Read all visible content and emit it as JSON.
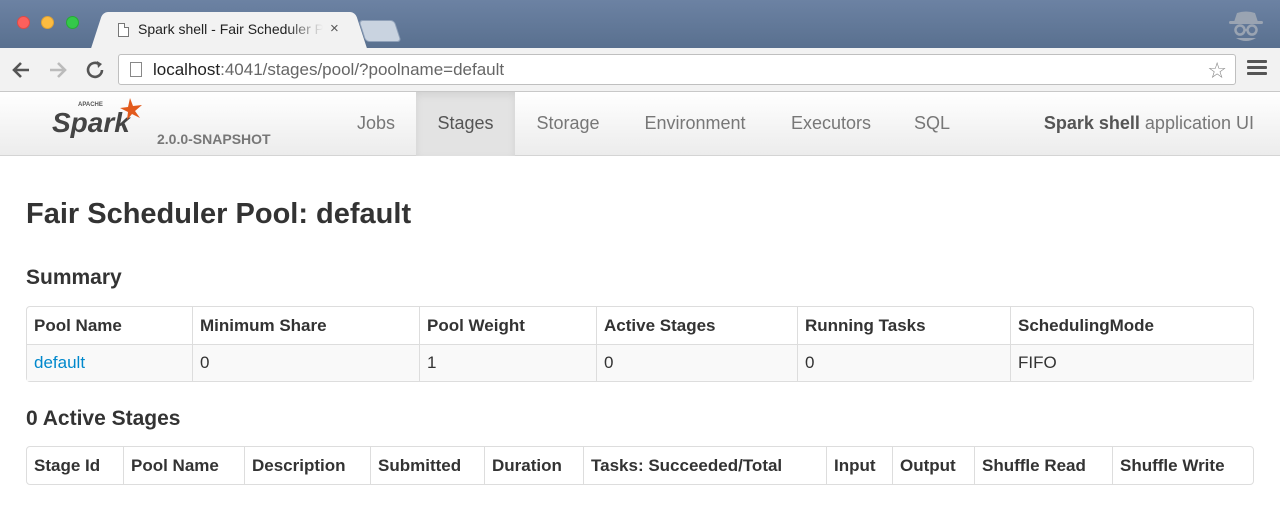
{
  "browser": {
    "tab_title": "Spark shell - Fair Scheduler Pool: default",
    "tab_close": "×",
    "url_host": "localhost",
    "url_rest": ":4041/stages/pool/?poolname=default",
    "star_icon": "☆"
  },
  "navbar": {
    "brand_version": "2.0.0-SNAPSHOT",
    "items": [
      {
        "label": "Jobs"
      },
      {
        "label": "Stages"
      },
      {
        "label": "Storage"
      },
      {
        "label": "Environment"
      },
      {
        "label": "Executors"
      },
      {
        "label": "SQL"
      }
    ],
    "active_item": "Stages",
    "app_name_bold": "Spark shell",
    "app_name_rest": " application UI"
  },
  "page": {
    "title": "Fair Scheduler Pool: default"
  },
  "summary": {
    "heading": "Summary",
    "headers": [
      "Pool Name",
      "Minimum Share",
      "Pool Weight",
      "Active Stages",
      "Running Tasks",
      "SchedulingMode"
    ],
    "row": [
      "default",
      "0",
      "1",
      "0",
      "0",
      "FIFO"
    ]
  },
  "active_stages": {
    "heading": "0 Active Stages",
    "headers": [
      "Stage Id",
      "Pool Name",
      "Description",
      "Submitted",
      "Duration",
      "Tasks: Succeeded/Total",
      "Input",
      "Output",
      "Shuffle Read",
      "Shuffle Write"
    ]
  },
  "colors": {
    "link": "#0088cc",
    "spark_orange": "#e25a1c",
    "titlebar": "#6c82a3"
  }
}
